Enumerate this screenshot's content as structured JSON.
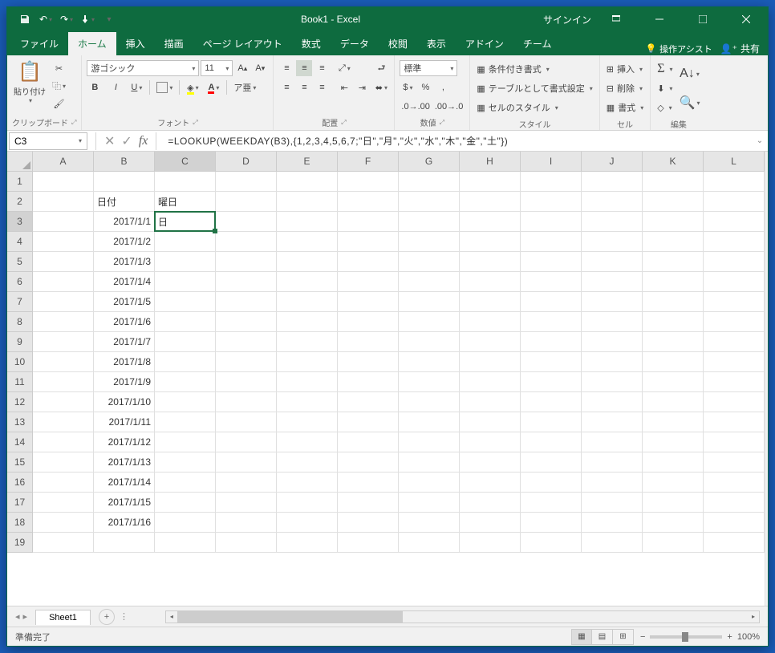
{
  "title": "Book1 - Excel",
  "signin": "サインイン",
  "tabs": {
    "file": "ファイル",
    "home": "ホーム",
    "insert": "挿入",
    "draw": "描画",
    "layout": "ページ レイアウト",
    "formulas": "数式",
    "data": "データ",
    "review": "校閲",
    "view": "表示",
    "addins": "アドイン",
    "team": "チーム",
    "tellme": "操作アシスト",
    "share": "共有"
  },
  "ribbon": {
    "clipboard": {
      "paste": "貼り付け",
      "label": "クリップボード"
    },
    "font": {
      "name": "游ゴシック",
      "size": "11",
      "label": "フォント"
    },
    "alignment": {
      "label": "配置"
    },
    "number": {
      "format": "標準",
      "label": "数値"
    },
    "styles": {
      "conditional": "条件付き書式",
      "table": "テーブルとして書式設定",
      "cell": "セルのスタイル",
      "label": "スタイル"
    },
    "cells": {
      "insert": "挿入",
      "delete": "削除",
      "format": "書式",
      "label": "セル"
    },
    "editing": {
      "label": "編集"
    }
  },
  "namebox": "C3",
  "formula": "=LOOKUP(WEEKDAY(B3),{1,2,3,4,5,6,7;\"日\",\"月\",\"火\",\"水\",\"木\",\"金\",\"土\"})",
  "columns": [
    "A",
    "B",
    "C",
    "D",
    "E",
    "F",
    "G",
    "H",
    "I",
    "J",
    "K",
    "L"
  ],
  "rows": [
    1,
    2,
    3,
    4,
    5,
    6,
    7,
    8,
    9,
    10,
    11,
    12,
    13,
    14,
    15,
    16,
    17,
    18,
    19
  ],
  "cells": {
    "B2": "日付",
    "C2": "曜日",
    "B3": "2017/1/1",
    "C3": "日",
    "B4": "2017/1/2",
    "B5": "2017/1/3",
    "B6": "2017/1/4",
    "B7": "2017/1/5",
    "B8": "2017/1/6",
    "B9": "2017/1/7",
    "B10": "2017/1/8",
    "B11": "2017/1/9",
    "B12": "2017/1/10",
    "B13": "2017/1/11",
    "B14": "2017/1/12",
    "B15": "2017/1/13",
    "B16": "2017/1/14",
    "B17": "2017/1/15",
    "B18": "2017/1/16"
  },
  "selected": "C3",
  "sheet": {
    "name": "Sheet1"
  },
  "status": {
    "ready": "準備完了",
    "zoom": "100%"
  }
}
